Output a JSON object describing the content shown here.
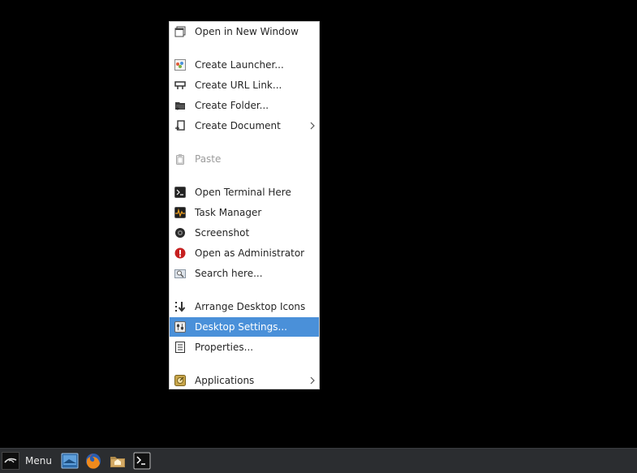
{
  "context_menu": {
    "items": [
      {
        "label": "Open in New Window",
        "icon": "window-icon"
      },
      {
        "label": "Create Launcher...",
        "icon": "launcher-icon"
      },
      {
        "label": "Create URL Link...",
        "icon": "url-link-icon"
      },
      {
        "label": "Create Folder...",
        "icon": "folder-new-icon"
      },
      {
        "label": "Create Document",
        "icon": "document-new-icon",
        "submenu": true
      },
      {
        "label": "Paste",
        "icon": "paste-icon",
        "disabled": true
      },
      {
        "label": "Open Terminal Here",
        "icon": "terminal-icon"
      },
      {
        "label": "Task Manager",
        "icon": "task-manager-icon"
      },
      {
        "label": "Screenshot",
        "icon": "camera-icon"
      },
      {
        "label": "Open as Administrator",
        "icon": "admin-warning-icon"
      },
      {
        "label": "Search here...",
        "icon": "search-icon"
      },
      {
        "label": "Arrange Desktop Icons",
        "icon": "arrange-icon"
      },
      {
        "label": "Desktop Settings...",
        "icon": "desktop-settings-icon",
        "selected": true
      },
      {
        "label": "Properties...",
        "icon": "properties-icon"
      },
      {
        "label": "Applications",
        "icon": "applications-icon",
        "submenu": true
      }
    ]
  },
  "taskbar": {
    "menu_label": "Menu",
    "launchers": [
      {
        "icon": "show-desktop-icon"
      },
      {
        "icon": "firefox-icon"
      },
      {
        "icon": "home-folder-icon"
      },
      {
        "icon": "terminal-icon"
      }
    ]
  },
  "colors": {
    "desktop_background": "#000000",
    "menu_background": "#ffffff",
    "selection": "#4a90d9",
    "taskbar": "#2b2d30"
  }
}
